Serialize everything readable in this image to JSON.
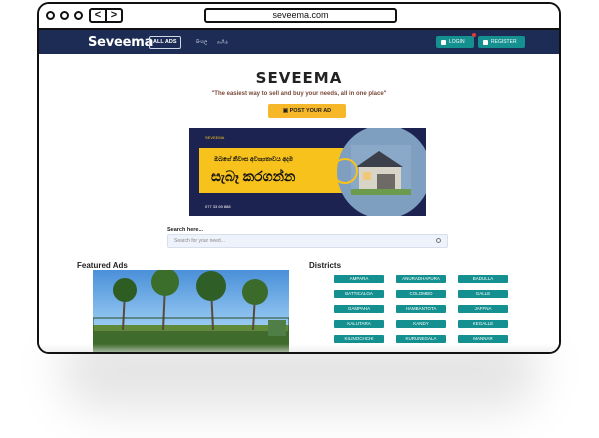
{
  "browser": {
    "url": "seveema.com",
    "back_glyph": "<",
    "forward_glyph": ">"
  },
  "nav": {
    "logo": "Seveema",
    "all_ads": "ALL ADS",
    "lang_sinhala": "සිංහල",
    "lang_tamil": "தமிழ்",
    "login": "LOGIN",
    "register": "REGISTER"
  },
  "hero": {
    "site_name": "SEVEEMA",
    "tagline": "\"The easiest way to sell and buy your needs, all in one place\"",
    "post_button": "POST YOUR AD"
  },
  "banner": {
    "brand": "SEVEEMA",
    "line1": "ඔබගේ නිවාස අවශ්‍යතාවය අදම",
    "line2": "සැබෑ කරගන්න",
    "phone": "077 33 69 888"
  },
  "search": {
    "label": "Search here...",
    "placeholder": "Search for your need..."
  },
  "featured": {
    "title": "Featured Ads"
  },
  "districts": {
    "title": "Districts",
    "items": [
      "AMPARA",
      "ANURADHAPURA",
      "BADULLA",
      "BATTICALOA",
      "COLOMBO",
      "GALLE",
      "GAMPAHA",
      "HAMBANTOTA",
      "JAFFNA",
      "KALUTARA",
      "KANDY",
      "KEGALLE",
      "KILINOCHCHI",
      "KURUNEGALA",
      "MANNAR"
    ]
  },
  "colors": {
    "navbar": "#1c2c55",
    "accent_teal": "#13908f",
    "post_yellow": "#f6b728",
    "banner_navy": "#1c2350",
    "banner_yellow": "#f7c21b"
  },
  "icons": {
    "search": "search-icon",
    "lock": "lock-icon",
    "register": "register-icon",
    "post": "post-icon"
  }
}
